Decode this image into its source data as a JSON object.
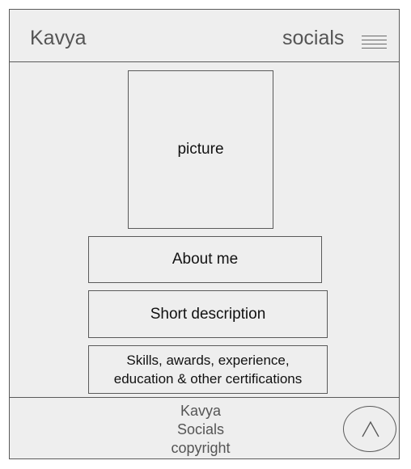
{
  "header": {
    "brand": "Kavya",
    "socials_label": "socials",
    "menu_icon": "hamburger-menu-icon"
  },
  "main": {
    "picture_placeholder": "picture",
    "about_label": "About me",
    "short_description_label": "Short description",
    "skills_lines": [
      "Skills, awards, experience,",
      "education & other certifications"
    ]
  },
  "footer": {
    "lines": [
      "Kavya",
      "Socials",
      "copyright"
    ],
    "scroll_top_icon": "chevron-up-icon"
  }
}
